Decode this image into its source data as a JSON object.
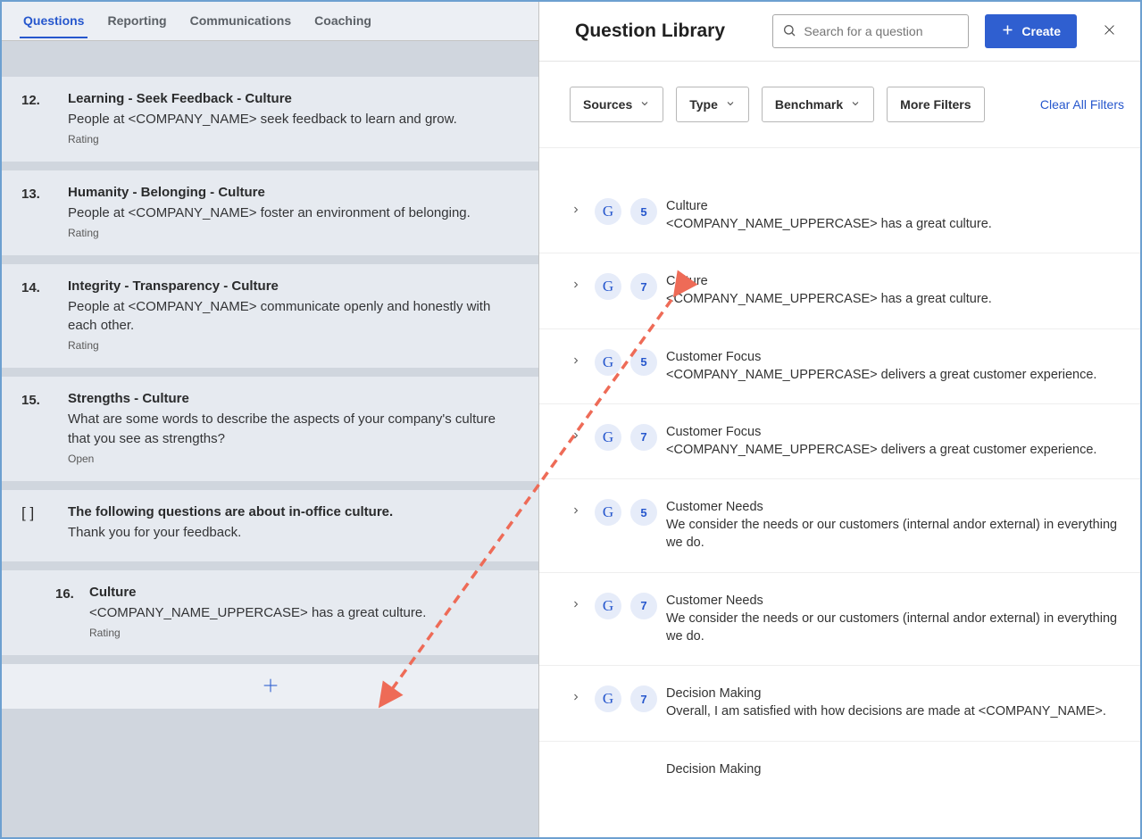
{
  "tabs": {
    "questions": "Questions",
    "reporting": "Reporting",
    "communications": "Communications",
    "coaching": "Coaching"
  },
  "questions": {
    "q12": {
      "num": "12.",
      "title": "Learning - Seek Feedback - Culture",
      "text": "People at <COMPANY_NAME> seek feedback to learn and grow.",
      "type": "Rating"
    },
    "q13": {
      "num": "13.",
      "title": "Humanity - Belonging - Culture",
      "text": "People at <COMPANY_NAME> foster an environment of belonging.",
      "type": "Rating"
    },
    "q14": {
      "num": "14.",
      "title": "Integrity - Transparency - Culture",
      "text": "People at <COMPANY_NAME> communicate openly and honestly with each other.",
      "type": "Rating"
    },
    "q15": {
      "num": "15.",
      "title": "Strengths - Culture",
      "text": "What are some words to describe the aspects of your company's culture that you see as strengths?",
      "type": "Open"
    },
    "section": {
      "bracket": "[ ]",
      "title": "The following questions are about in-office culture.",
      "text": "Thank you for your feedback."
    },
    "q16": {
      "num": "16.",
      "title": "Culture",
      "text": "<COMPANY_NAME_UPPERCASE> has a great culture.",
      "type": "Rating"
    }
  },
  "right": {
    "title": "Question Library",
    "search_placeholder": "Search for a question",
    "create_label": "Create",
    "filters": {
      "sources": "Sources",
      "type": "Type",
      "benchmark": "Benchmark",
      "more": "More Filters",
      "clear": "Clear All Filters"
    },
    "items": {
      "i1": {
        "count": "5",
        "cat": "Culture",
        "text": "<COMPANY_NAME_UPPERCASE> has a great culture."
      },
      "i2": {
        "count": "7",
        "cat": "Culture",
        "text": "<COMPANY_NAME_UPPERCASE> has a great culture."
      },
      "i3": {
        "count": "5",
        "cat": "Customer Focus",
        "text": "<COMPANY_NAME_UPPERCASE> delivers a great customer experience."
      },
      "i4": {
        "count": "7",
        "cat": "Customer Focus",
        "text": "<COMPANY_NAME_UPPERCASE> delivers a great customer experience."
      },
      "i5": {
        "count": "5",
        "cat": "Customer Needs",
        "text": "We consider the needs or our customers (internal andor external) in everything we do."
      },
      "i6": {
        "count": "7",
        "cat": "Customer Needs",
        "text": "We consider the needs or our customers (internal andor external) in everything we do."
      },
      "i7": {
        "count": "7",
        "cat": "Decision Making",
        "text": "Overall, I am satisfied with how decisions are made at <COMPANY_NAME>."
      },
      "i8": {
        "cat": "Decision Making"
      }
    }
  }
}
